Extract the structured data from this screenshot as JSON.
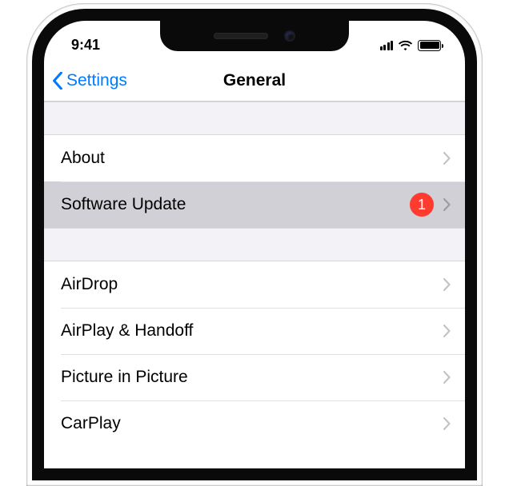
{
  "status": {
    "time": "9:41"
  },
  "nav": {
    "back": "Settings",
    "title": "General"
  },
  "section1": [
    {
      "label": "About",
      "badge": null,
      "selected": false
    },
    {
      "label": "Software Update",
      "badge": "1",
      "selected": true
    }
  ],
  "section2": [
    {
      "label": "AirDrop",
      "badge": null
    },
    {
      "label": "AirPlay & Handoff",
      "badge": null
    },
    {
      "label": "Picture in Picture",
      "badge": null
    },
    {
      "label": "CarPlay",
      "badge": null
    }
  ]
}
